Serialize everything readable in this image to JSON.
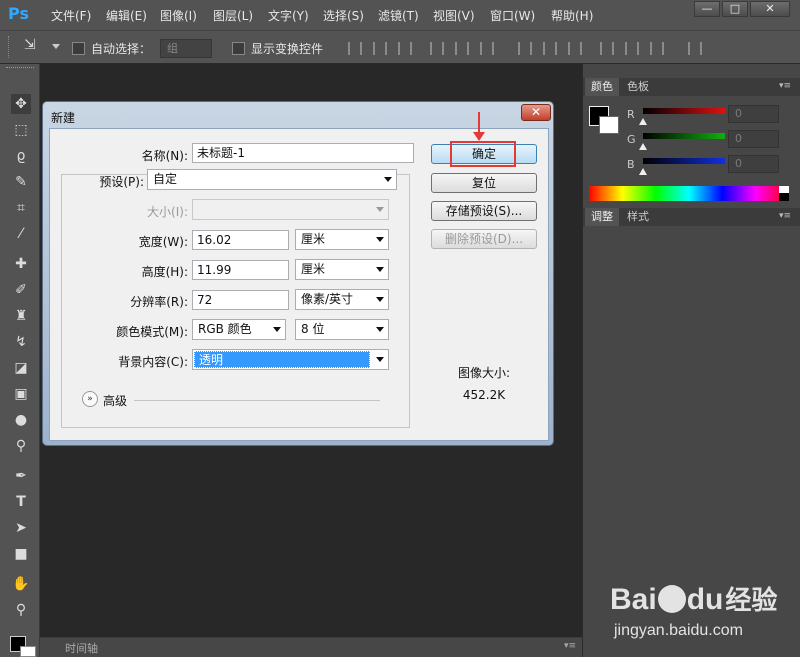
{
  "app": {
    "logo": "Ps"
  },
  "menu": [
    "文件(F)",
    "编辑(E)",
    "图像(I)",
    "图层(L)",
    "文字(Y)",
    "选择(S)",
    "滤镜(T)",
    "视图(V)",
    "窗口(W)",
    "帮助(H)"
  ],
  "window_controls": {
    "minimize": "—",
    "maximize": "□",
    "close": "✕"
  },
  "options_bar": {
    "auto_select_label": "自动选择：",
    "auto_select_value": "组",
    "show_transform_label": "显示变换控件"
  },
  "panels": {
    "color_tabs": [
      "颜色",
      "色板"
    ],
    "channels": [
      {
        "label": "R",
        "value": "0",
        "color": "#e01010"
      },
      {
        "label": "G",
        "value": "0",
        "color": "#10b010"
      },
      {
        "label": "B",
        "value": "0",
        "color": "#1030e0"
      }
    ],
    "adjust_tabs": [
      "调整",
      "样式"
    ]
  },
  "timeline_label": "时间轴",
  "dialog": {
    "title": "新建",
    "close": "✕",
    "name_label": "名称(N):",
    "name_value": "未标题-1",
    "preset_label": "预设(P):",
    "preset_value": "自定",
    "size_label": "大小(I):",
    "width_label": "宽度(W):",
    "width_value": "16.02",
    "width_unit": "厘米",
    "height_label": "高度(H):",
    "height_value": "11.99",
    "height_unit": "厘米",
    "resolution_label": "分辨率(R):",
    "resolution_value": "72",
    "resolution_unit": "像素/英寸",
    "color_mode_label": "颜色模式(M):",
    "color_mode_value": "RGB 颜色",
    "bit_depth_value": "8 位",
    "background_label": "背景内容(C):",
    "background_value": "透明",
    "advanced_label": "高级",
    "ok_button": "确定",
    "reset_button": "复位",
    "save_preset_button": "存储预设(S)...",
    "delete_preset_button": "删除预设(D)...",
    "image_size_label": "图像大小:",
    "image_size_value": "452.2K"
  },
  "watermark": {
    "brand": "Bai",
    "brand2": "du",
    "brand_cn": "经验",
    "url": "jingyan.baidu.com"
  }
}
